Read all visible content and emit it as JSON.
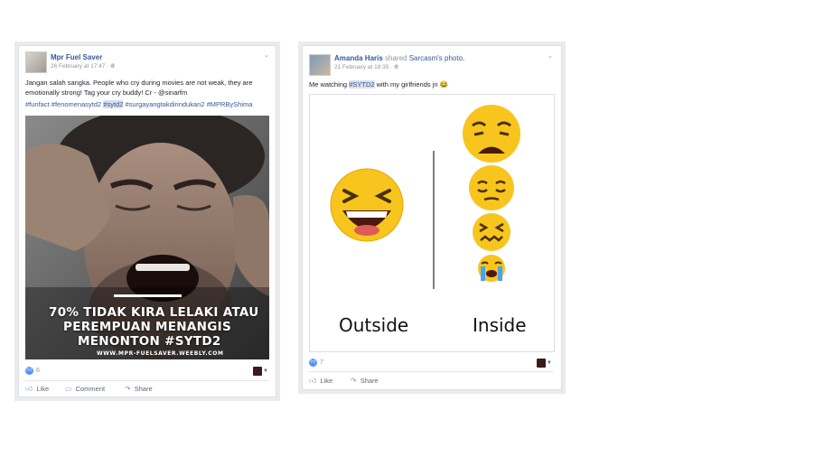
{
  "posts": [
    {
      "author": "Mpr Fuel Saver",
      "timestamp": "26 February at 17:47 · ",
      "globe_icon": "globe-icon",
      "text": "Jangan salah sangka. People who cry during movies are not weak, they are emotionally strong! Tag your cry buddy! Cr - @sinarfm",
      "hashtags": {
        "part1": "#funfact #fenomenasytd2 ",
        "highlighted": "#sytd2",
        "part2": " #surgayangtakdirindukan2 #MPRByShima"
      },
      "image_overlay": {
        "line1": "70% TIDAK KIRA LELAKI ATAU",
        "line2": "PEREMPUAN MENANGIS",
        "line3": "MENONTON #SYTD2",
        "url": "WWW.MPR-FUELSAVER.WEEBLY.COM"
      },
      "reaction_count": "6",
      "actions": {
        "like": "Like",
        "comment": "Comment",
        "share": "Share"
      }
    },
    {
      "author": "Amanda Haris",
      "shared_text": " shared ",
      "shared_source": "Sarcasm's photo.",
      "timestamp": "21 February at 18:35 · ",
      "text_before": "Me watching ",
      "text_tag": "#SYTD2",
      "text_after": " with my girlfriends jn ",
      "emoji_name": "laughing-emoji",
      "meme": {
        "left_label": "Outside",
        "right_label": "Inside"
      },
      "reaction_count": "7",
      "actions": {
        "like": "Like",
        "share": "Share"
      }
    }
  ],
  "colors": {
    "link": "#365899",
    "muted": "#90949c",
    "like_blue": "#5890ff",
    "emoji_yellow": "#f7c51e"
  }
}
